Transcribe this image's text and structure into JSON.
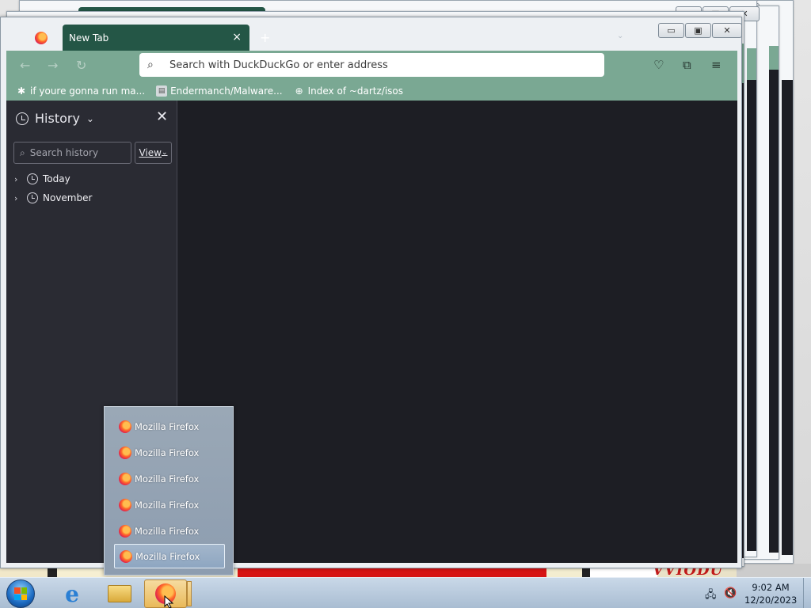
{
  "browser": {
    "tab": {
      "title": "New Tab",
      "close": "×"
    },
    "new_tab": "+",
    "tab_list": "⌄",
    "window_controls": {
      "minimize": "▭",
      "maximize": "▣",
      "close": "✕"
    },
    "nav": {
      "back": "←",
      "forward": "→",
      "reload": "↻"
    },
    "urlbar": {
      "placeholder": "Search with DuckDuckGo or enter address",
      "value": ""
    },
    "toolbar": {
      "pocket": "♡",
      "extensions": "⧉",
      "menu": "≡"
    },
    "bookmarks": [
      {
        "label": "if youre gonna run ma...",
        "icon": "bug-icon"
      },
      {
        "label": "Endermanch/Malware...",
        "icon": "page-icon"
      },
      {
        "label": "Index of ~dartz/isos",
        "icon": "globe-icon"
      }
    ]
  },
  "sidebar": {
    "title": "History",
    "title_chevron": "⌄",
    "close": "✕",
    "search_placeholder": "Search history",
    "search_glyph": "⌕",
    "view_button": "View",
    "items": [
      {
        "label": "Today"
      },
      {
        "label": "November"
      }
    ],
    "chevron": "›"
  },
  "jump_list": {
    "items": [
      {
        "label": "Mozilla Firefox"
      },
      {
        "label": "Mozilla Firefox"
      },
      {
        "label": "Mozilla Firefox"
      },
      {
        "label": "Mozilla Firefox"
      },
      {
        "label": "Mozilla Firefox"
      },
      {
        "label": "Mozilla Firefox",
        "selected": true
      }
    ]
  },
  "taskbar": {
    "time": "9:02 AM",
    "date": "12/20/2023",
    "ie_glyph": "e",
    "tray": {
      "network": "🖧",
      "volume": "🔇"
    }
  },
  "colors": {
    "tab_active": "#245646",
    "toolbar": "#7aa893",
    "sidebar_bg": "#2a2b33",
    "content_bg": "#1d1e24"
  }
}
